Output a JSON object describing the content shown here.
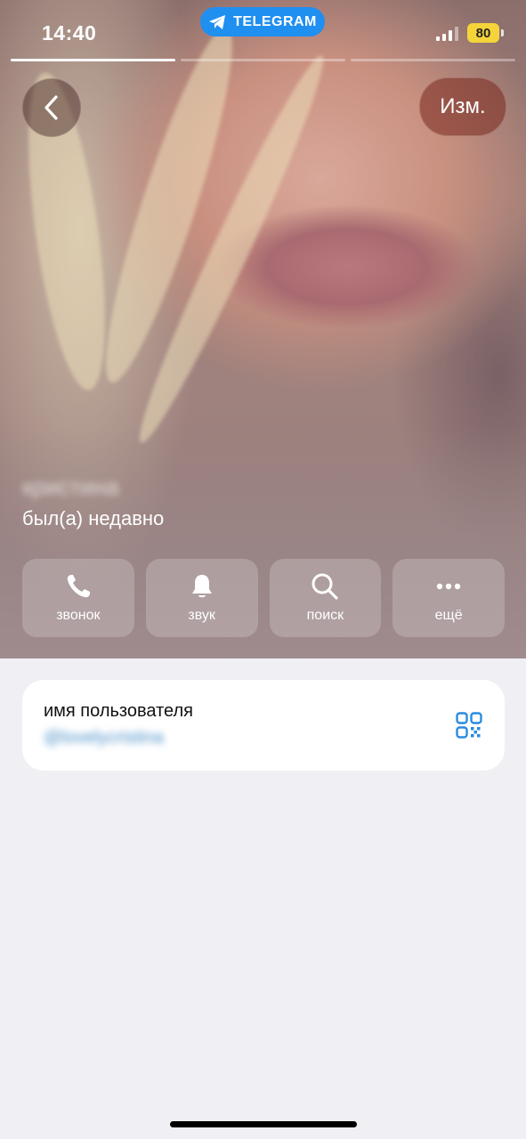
{
  "status_bar": {
    "time": "14:40",
    "app_pill": "TELEGRAM",
    "battery": "80"
  },
  "nav": {
    "back_icon": "chevron-left-icon",
    "edit_label": "Изм."
  },
  "profile": {
    "name": "кристина",
    "status": "был(а) недавно"
  },
  "actions": [
    {
      "label": "звонок",
      "icon": "phone-icon"
    },
    {
      "label": "звук",
      "icon": "bell-icon"
    },
    {
      "label": "поиск",
      "icon": "search-icon"
    },
    {
      "label": "ещё",
      "icon": "more-icon"
    }
  ],
  "info": {
    "label": "имя пользователя",
    "value": "@lovelycristina",
    "icon": "qr-code-icon"
  },
  "colors": {
    "telegram_blue": "#1f8ff0",
    "link_blue": "#4a90c8",
    "battery_yellow": "#f4d43a",
    "background": "#efeff4"
  }
}
